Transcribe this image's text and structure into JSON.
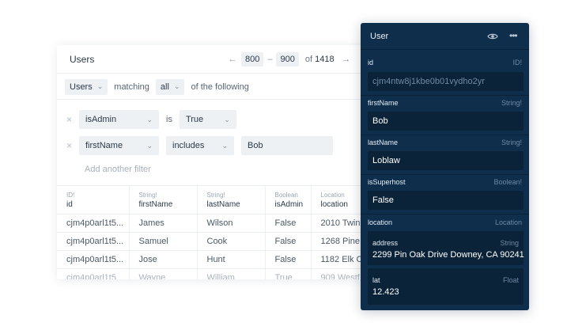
{
  "users_card": {
    "title": "Users",
    "pager": {
      "prev_icon": "arrow-left-icon",
      "from": "800",
      "dash": "–",
      "to": "900",
      "of_label": "of",
      "total": "1418",
      "next_icon": "arrow-right-icon"
    },
    "filter_bar": {
      "model": "Users",
      "matching": "matching",
      "mode": "all",
      "suffix": "of the following"
    },
    "filters": [
      {
        "field": "isAdmin",
        "operator": "is",
        "value": "True"
      },
      {
        "field": "firstName",
        "operator": "includes",
        "value": "Bob"
      }
    ],
    "add_filter": "Add another filter",
    "columns": [
      {
        "type": "ID!",
        "name": "id"
      },
      {
        "type": "String!",
        "name": "firstName"
      },
      {
        "type": "String!",
        "name": "lastName"
      },
      {
        "type": "Boolean",
        "name": "isAdmin"
      },
      {
        "type": "Location",
        "name": "location"
      }
    ],
    "rows": [
      [
        "cjm4p0arl1t5...",
        "James",
        "Wilson",
        "False",
        "2010 Twin"
      ],
      [
        "cjm4p0arl1t5...",
        "Samuel",
        "Cook",
        "False",
        "1268 Pine"
      ],
      [
        "cjm4p0arl1t5...",
        "Jose",
        "Hunt",
        "False",
        "1182 Elk C"
      ],
      [
        "cjm4p0arl1t5",
        "Wayne",
        "William",
        "True",
        "909 Westf"
      ]
    ]
  },
  "user_panel": {
    "title": "User",
    "icons": {
      "visibility": "eye-icon",
      "more": "more-icon"
    },
    "more_glyph": "•••",
    "fields": {
      "id": {
        "label": "id",
        "type": "ID!",
        "value": "cjm4ntw8j1kbe0b01vydho2yr"
      },
      "firstName": {
        "label": "firstName",
        "type": "String!",
        "value": "Bob"
      },
      "lastName": {
        "label": "lastName",
        "type": "String!",
        "value": "Loblaw"
      },
      "isSuperhost": {
        "label": "isSuperhost",
        "type": "Boolean!",
        "value": "False"
      },
      "location": {
        "label": "location",
        "type": "Location"
      },
      "address": {
        "label": "address",
        "type": "String",
        "value": "2299 Pin Oak Drive Downey, CA 90241"
      },
      "lat": {
        "label": "lat",
        "type": "Float",
        "value": "12.423"
      }
    }
  },
  "colors": {
    "panel_bg": "#0e2e4b",
    "panel_field_bg": "#0a2338",
    "chip_bg": "#eef1f4",
    "muted_text": "#6f8aa3"
  }
}
